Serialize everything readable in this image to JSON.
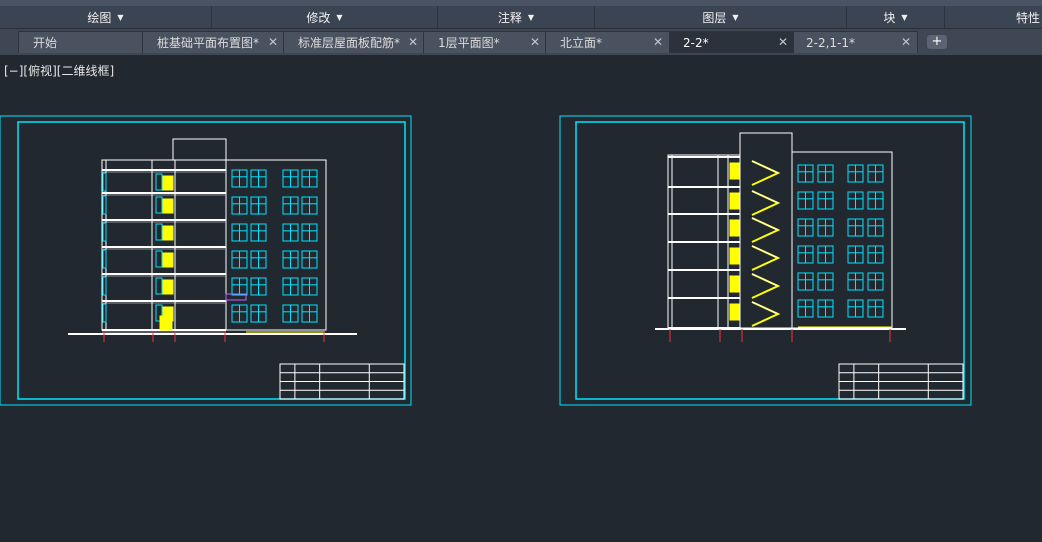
{
  "ribbon": {
    "panels": [
      {
        "label": "绘图"
      },
      {
        "label": "修改"
      },
      {
        "label": "注释"
      },
      {
        "label": "图层"
      },
      {
        "label": "块"
      },
      {
        "label": "特性"
      }
    ]
  },
  "tabs": [
    {
      "label": "开始",
      "closable": false,
      "active": false
    },
    {
      "label": "桩基础平面布置图*",
      "closable": true,
      "active": false
    },
    {
      "label": "标准层屋面板配筋*",
      "closable": true,
      "active": false
    },
    {
      "label": "1层平面图*",
      "closable": true,
      "active": false
    },
    {
      "label": "北立面*",
      "closable": true,
      "active": false
    },
    {
      "label": "2-2*",
      "closable": true,
      "active": true
    },
    {
      "label": "2-2,1-1*",
      "closable": true,
      "active": false
    }
  ],
  "tab_close_glyph": "✕",
  "tab_add_glyph": "+",
  "viewport_label": "[−][俯视][二维线框]",
  "colors": {
    "background": "#212830",
    "frame": "#00e5ff",
    "geometry": "#ffffff",
    "window": "#00e5ff",
    "stair": "#ffff00",
    "axis": "#ff3030"
  }
}
